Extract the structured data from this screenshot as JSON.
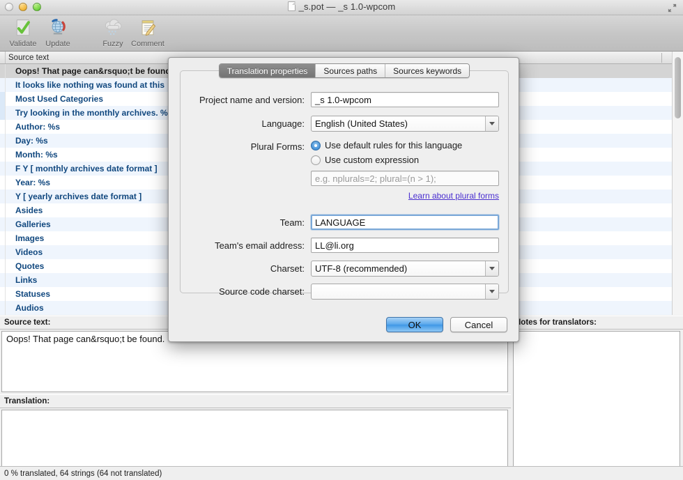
{
  "window": {
    "title": "_s.pot — _s 1.0-wpcom",
    "doc_icon": "document-icon",
    "fullscreen_icon": "fullscreen-icon",
    "traffic_lights": [
      "close",
      "minimize",
      "zoom"
    ]
  },
  "toolbar": {
    "items": [
      {
        "label": "Validate",
        "icon": "validate-checkmark-icon"
      },
      {
        "label": "Update",
        "icon": "update-globe-icon"
      },
      {
        "label": "Fuzzy",
        "icon": "fuzzy-clouds-icon"
      },
      {
        "label": "Comment",
        "icon": "comment-notepad-icon"
      }
    ]
  },
  "list": {
    "header": "Source text",
    "rows": [
      "Oops! That page can&rsquo;t be found.",
      "It looks like nothing was found at this",
      "Most Used Categories",
      "Try looking in the monthly archives. %",
      "Author: %s",
      "Day: %s",
      "Month: %s",
      "F Y  [ monthly archives date format ]",
      "Year: %s",
      "Y  [ yearly archives date format ]",
      "Asides",
      "Galleries",
      "Images",
      "Videos",
      "Quotes",
      "Links",
      "Statuses",
      "Audios"
    ]
  },
  "panes": {
    "source_title": "Source text:",
    "source_value": "Oops! That page can&rsquo;t be found.",
    "translation_title": "Translation:",
    "translation_value": "",
    "notes_title": "Notes for translators:",
    "notes_value": ""
  },
  "status": {
    "text": "0 % translated, 64 strings (64 not translated)"
  },
  "dialog": {
    "tabs": [
      {
        "label": "Translation properties",
        "active": true
      },
      {
        "label": "Sources paths",
        "active": false
      },
      {
        "label": "Sources keywords",
        "active": false
      }
    ],
    "fields": {
      "project_label": "Project name and version:",
      "project_value": "_s 1.0-wpcom",
      "language_label": "Language:",
      "language_value": "English (United States)",
      "plural_label": "Plural Forms:",
      "plural_default_option": "Use default rules for this language",
      "plural_custom_option": "Use custom expression",
      "plural_expression_placeholder": "e.g. nplurals=2; plural=(n > 1);",
      "plural_expression_value": "",
      "plural_link": "Learn about plural forms",
      "team_label": "Team:",
      "team_value": "LANGUAGE",
      "email_label": "Team's email address:",
      "email_value": "LL@li.org",
      "charset_label": "Charset:",
      "charset_value": "UTF-8 (recommended)",
      "source_charset_label": "Source code charset:",
      "source_charset_value": ""
    },
    "buttons": {
      "ok": "OK",
      "cancel": "Cancel"
    }
  },
  "colors": {
    "accent_blue": "#3f97e6",
    "list_text": "#11487f",
    "alt_row": "#eff5fd",
    "selected_row": "#d4d4d4",
    "link": "#4a2fd0"
  }
}
